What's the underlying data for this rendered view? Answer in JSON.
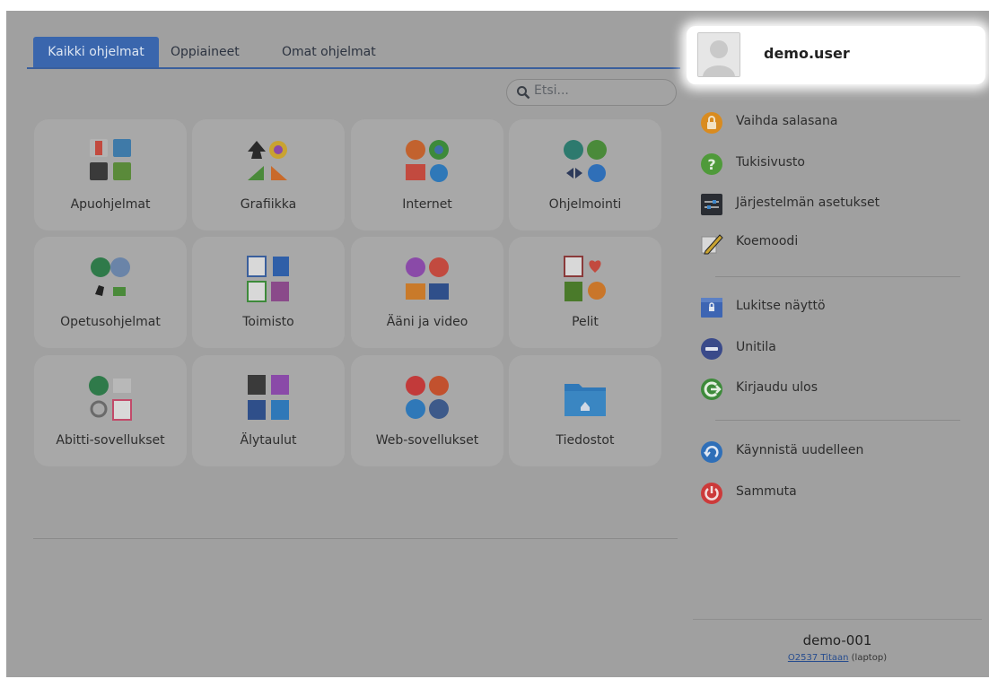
{
  "tabs": [
    {
      "label": "Kaikki ohjelmat",
      "active": true
    },
    {
      "label": "Oppiaineet",
      "active": false
    },
    {
      "label": "Omat ohjelmat",
      "active": false
    }
  ],
  "search": {
    "placeholder": "Etsi..."
  },
  "categories": [
    {
      "label": "Apuohjelmat"
    },
    {
      "label": "Grafiikka"
    },
    {
      "label": "Internet"
    },
    {
      "label": "Ohjelmointi"
    },
    {
      "label": "Opetusohjelmat"
    },
    {
      "label": "Toimisto"
    },
    {
      "label": "Ääni ja video"
    },
    {
      "label": "Pelit"
    },
    {
      "label": "Abitti-sovellukset"
    },
    {
      "label": "Älytaulut"
    },
    {
      "label": "Web-sovellukset"
    },
    {
      "label": "Tiedostot"
    }
  ],
  "user": {
    "name": "demo.user"
  },
  "menu": {
    "change_password": "Vaihda salasana",
    "support": "Tukisivusto",
    "settings": "Järjestelmän asetukset",
    "exam_mode": "Koemoodi",
    "lock_screen": "Lukitse näyttö",
    "sleep": "Unitila",
    "logout": "Kirjaudu ulos",
    "restart": "Käynnistä uudelleen",
    "shutdown": "Sammuta"
  },
  "footer": {
    "hostname": "demo-001",
    "device_link": "O2537 Titaan",
    "device_type": "(laptop)"
  },
  "colors": {
    "accent": "#3a66ad",
    "orange": "#d98b1f",
    "green": "#4f9a3a",
    "blue": "#3d65b3",
    "red": "#cc3a3a"
  }
}
